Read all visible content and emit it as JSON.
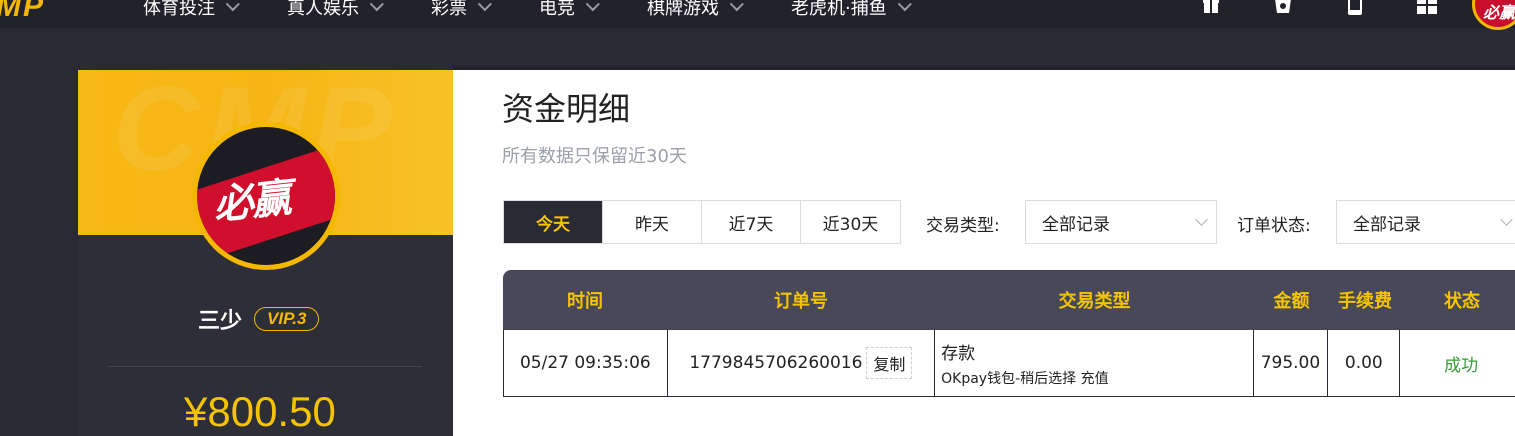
{
  "nav": {
    "logo": "MP",
    "items": [
      {
        "label": "体育投注"
      },
      {
        "label": "真人娱乐"
      },
      {
        "label": "彩票"
      },
      {
        "label": "电竞"
      },
      {
        "label": "棋牌游戏"
      },
      {
        "label": "老虎机·捕鱼"
      }
    ],
    "icons": [
      "gift-icon",
      "bag-icon",
      "mobile-icon",
      "grid-icon"
    ],
    "avatar_text": "必赢"
  },
  "sidebar": {
    "avatar_text": "必赢",
    "username": "三少",
    "vip": "VIP.3",
    "balance": "¥800.50"
  },
  "main": {
    "title": "资金明细",
    "subtitle": "所有数据只保留近30天",
    "date_tabs": [
      {
        "label": "今天",
        "active": true
      },
      {
        "label": "昨天",
        "active": false
      },
      {
        "label": "近7天",
        "active": false
      },
      {
        "label": "近30天",
        "active": false
      }
    ],
    "filters": {
      "type_label": "交易类型:",
      "type_value": "全部记录",
      "status_label": "订单状态:",
      "status_value": "全部记录"
    },
    "table": {
      "headers": [
        "时间",
        "订单号",
        "交易类型",
        "金额",
        "手续费",
        "状态"
      ],
      "rows": [
        {
          "time": "05/27 09:35:06",
          "order_no": "1779845706260016",
          "copy_label": "复制",
          "type_main": "存款",
          "type_sub": "OKpay钱包-稍后选择 充值",
          "amount": "795.00",
          "fee": "0.00",
          "status": "成功"
        }
      ]
    }
  },
  "colors": {
    "accent": "#f5c400",
    "dark": "#2a2a35",
    "header": "#484858",
    "success": "#3a9b3a"
  }
}
